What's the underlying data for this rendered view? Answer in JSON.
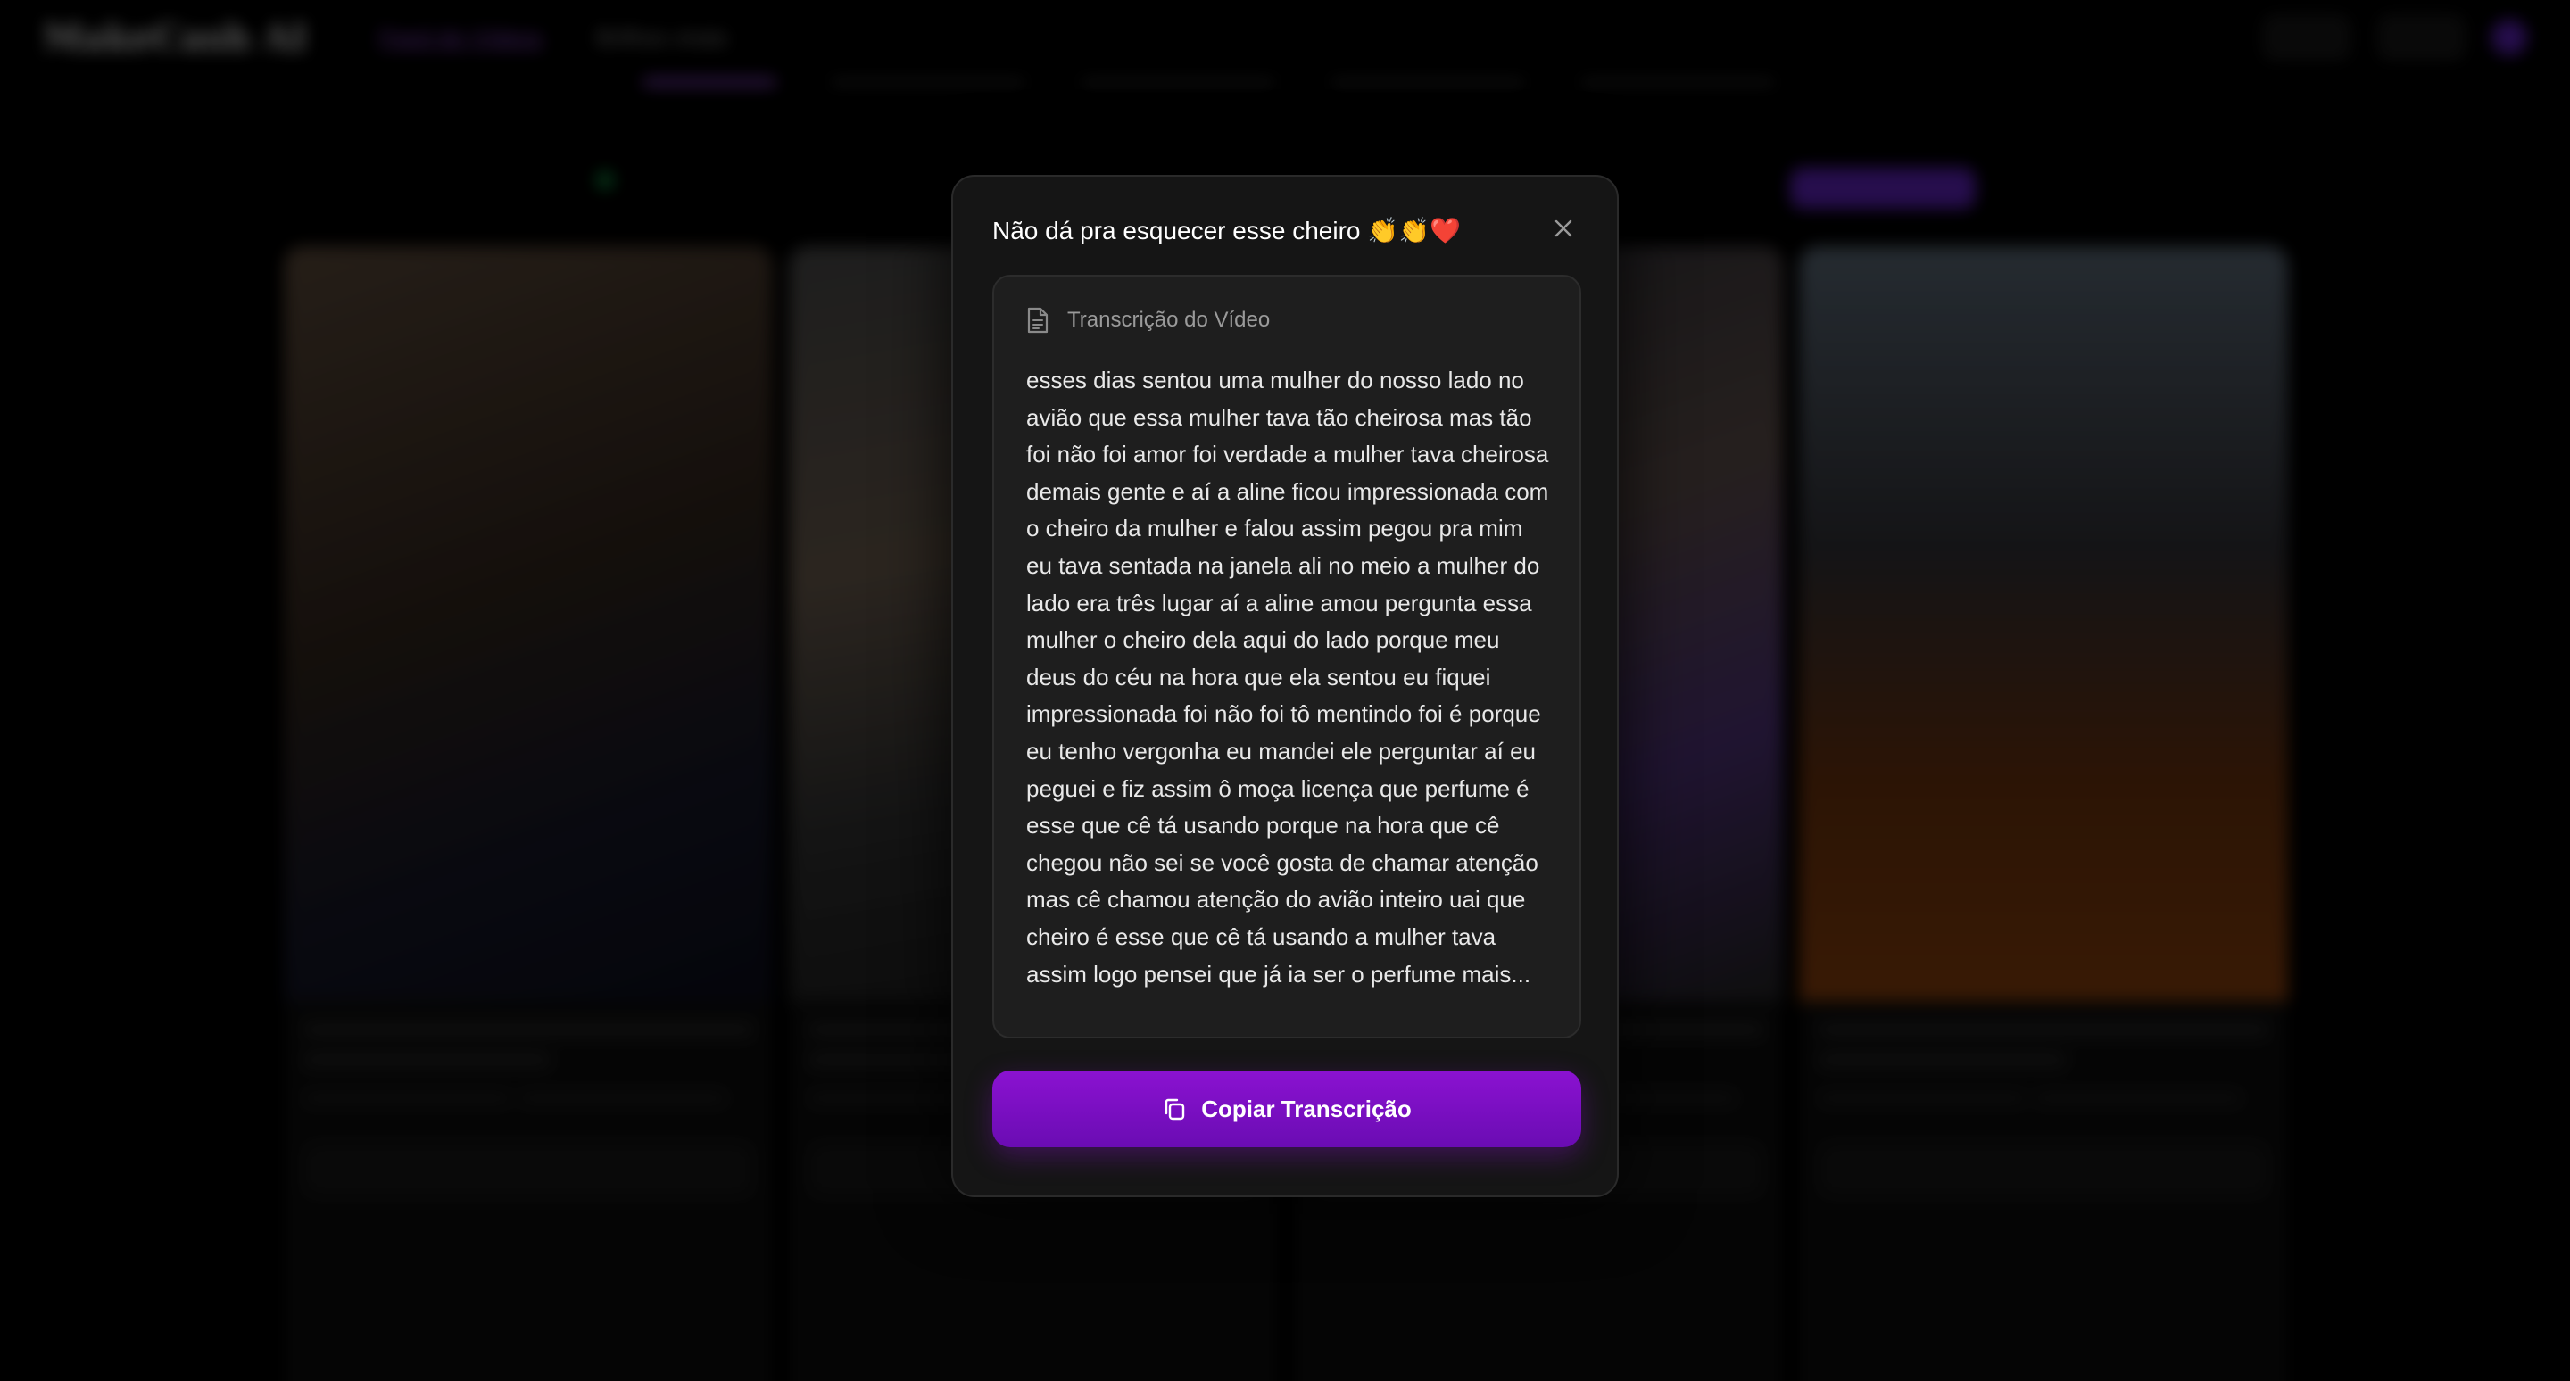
{
  "background": {
    "logo": "MakeCash AI",
    "nav": [
      "Feed de Vídeos",
      "Brilhos virais"
    ],
    "cards": [
      {
        "title": "Não dá pra esquecer esse cheiro 👏👏❤️"
      },
      {
        "title": ""
      },
      {
        "title": ""
      },
      {
        "title": ""
      }
    ]
  },
  "modal": {
    "title": "Não dá pra esquecer esse cheiro 👏👏❤️",
    "close_icon": "close-icon",
    "transcript_header": "Transcrição do Vídeo",
    "transcript_icon": "document-icon",
    "transcript": "esses dias sentou uma mulher do nosso lado no avião que essa mulher tava tão cheirosa mas tão foi não foi amor foi verdade a mulher tava cheirosa demais gente e aí a aline ficou impressionada com o cheiro da mulher e falou assim pegou pra mim eu tava sentada na janela ali no meio a mulher do lado era três lugar aí a aline amou pergunta essa mulher o cheiro dela aqui do lado porque meu deus do céu na hora que ela sentou eu fiquei impressionada foi não foi tô mentindo foi é porque eu tenho vergonha eu mandei ele perguntar aí eu peguei e fiz assim ô moça licença que perfume é esse que cê tá usando porque na hora que cê chegou não sei se você gosta de chamar atenção mas cê chamou atenção do avião inteiro uai que cheiro é esse que cê tá usando a mulher tava assim logo pensei que já ia ser o perfume mais...",
    "copy_button": "Copiar Transcrição",
    "copy_icon": "copy-icon"
  },
  "colors": {
    "accent": "#8b12d1",
    "modal_bg": "#151515",
    "box_bg": "#1e1e1e"
  }
}
